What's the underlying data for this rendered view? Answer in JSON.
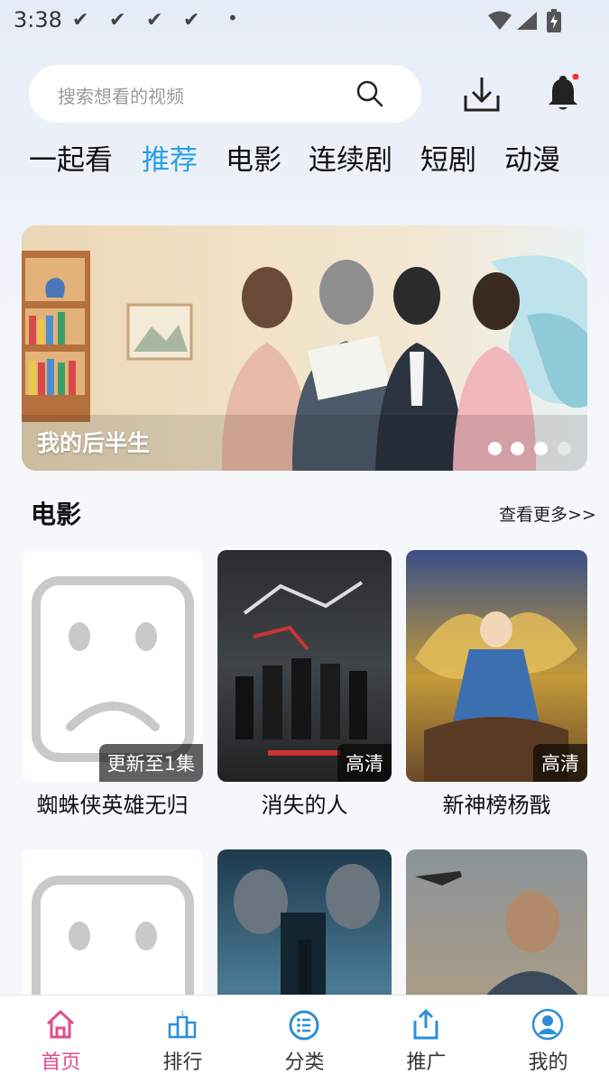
{
  "status_bar": {
    "time": "3:38",
    "check_mark": "✔",
    "dot": "•",
    "icons": [
      "wifi-icon",
      "signal-icon",
      "battery-charging-icon"
    ]
  },
  "header": {
    "search_placeholder": "搜索想看的视频",
    "icons": [
      "search-icon",
      "download-icon",
      "bell-icon"
    ],
    "notification_dot_color": "#ff2d2d"
  },
  "tabs": [
    {
      "label": "一起看",
      "active": false
    },
    {
      "label": "推荐",
      "active": true
    },
    {
      "label": "电影",
      "active": false
    },
    {
      "label": "连续剧",
      "active": false
    },
    {
      "label": "短剧",
      "active": false
    },
    {
      "label": "动漫",
      "active": false
    }
  ],
  "banner": {
    "title": "我的后半生",
    "dots_total": 4,
    "dots_active": 3
  },
  "section": {
    "title": "电影",
    "more": "查看更多>>"
  },
  "cards": [
    {
      "title": "蜘蛛侠英雄无归",
      "badge": "更新至1集",
      "placeholder": true
    },
    {
      "title": "消失的人",
      "badge": "高清",
      "placeholder": false
    },
    {
      "title": "新神榜杨戬",
      "badge": "高清",
      "placeholder": false
    },
    {
      "title": "",
      "badge": "",
      "placeholder": true
    },
    {
      "title": "",
      "badge": "",
      "placeholder": false
    },
    {
      "title": "",
      "badge": "",
      "placeholder": false
    }
  ],
  "bottom_nav": [
    {
      "label": "首页",
      "icon": "home-icon",
      "active": true
    },
    {
      "label": "排行",
      "icon": "ranking-icon",
      "active": false
    },
    {
      "label": "分类",
      "icon": "category-icon",
      "active": false
    },
    {
      "label": "推广",
      "icon": "share-icon",
      "active": false
    },
    {
      "label": "我的",
      "icon": "profile-icon",
      "active": false
    }
  ],
  "colors": {
    "accent": "#2aa0e6",
    "nav_active": "#e04d8c"
  }
}
